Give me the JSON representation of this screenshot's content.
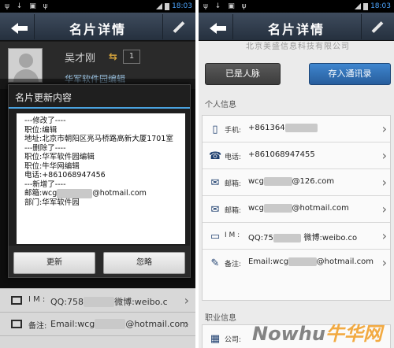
{
  "status": {
    "time": "18:03",
    "left_icons": "ψ ↓ ▣ ψ"
  },
  "left": {
    "title": "名片详情",
    "profile": {
      "name": "吴才刚",
      "company": "华军软件园编辑",
      "count": "1"
    },
    "dialog": {
      "title": "名片更新内容",
      "lines": [
        "---修改了----",
        "职位:编辑",
        "地址:北京市朝阳区亮马桥路高新大厦1701室",
        "---删除了----",
        "职位:华军软件园编辑",
        "职位:牛华网编辑",
        "电话:+861068947456",
        "---新增了----",
        "邮箱:wcg",
        "部门:华军软件园"
      ],
      "email_masked": "xxxxxxxx",
      "email_suffix": "@hotmail.com",
      "update_button": "更新",
      "ignore_button": "忽略"
    },
    "rows": [
      {
        "label": "I M :",
        "value": "QQ:758",
        "masked": "xxxxxx",
        "value2": "微博:weibo.c"
      },
      {
        "label": "备注:",
        "value": "Email:wcg",
        "masked": "xxxxxx",
        "value2": "@hotmail.com"
      }
    ]
  },
  "right": {
    "title": "名片详情",
    "partial_text": "北京美盛信息科技有限公司",
    "already_contact_button": "已是人脉",
    "save_contacts_button": "存入通讯录",
    "personal_section": "个人信息",
    "work_section": "职业信息",
    "rows": [
      {
        "icon": "phone-icon",
        "glyph": "▯",
        "label": "手机:",
        "value": "+861364",
        "masked": "xxxxxxx",
        "value2": ""
      },
      {
        "icon": "telephone-icon",
        "glyph": "☎",
        "label": "电话:",
        "value": "+861068947455",
        "masked": "",
        "value2": ""
      },
      {
        "icon": "mail-icon",
        "glyph": "✉",
        "label": "邮箱:",
        "value": "wcg",
        "masked": "xxxxxx",
        "value2": "@126.com"
      },
      {
        "icon": "mail-icon",
        "glyph": "✉",
        "label": "邮箱:",
        "value": "wcg",
        "masked": "xxxxxx",
        "value2": "@hotmail.com"
      },
      {
        "icon": "chat-icon",
        "glyph": "▭",
        "label": "I M :",
        "value": "QQ:75",
        "masked": "xxxxxx",
        "value2": " 微博:weibo.co"
      },
      {
        "icon": "note-icon",
        "glyph": "✎",
        "label": "备注:",
        "value": "Email:wcg",
        "masked": "xxxxxx",
        "value2": "@hotmail.com"
      }
    ],
    "work_row": {
      "label": "公司:"
    },
    "watermark_a": "Nowhu",
    "watermark_b": "牛华网"
  },
  "colors": {
    "accent_blue": "#4aa3e0",
    "button_dark": "#4a4a4a",
    "button_blue": "#2f6fb5"
  }
}
